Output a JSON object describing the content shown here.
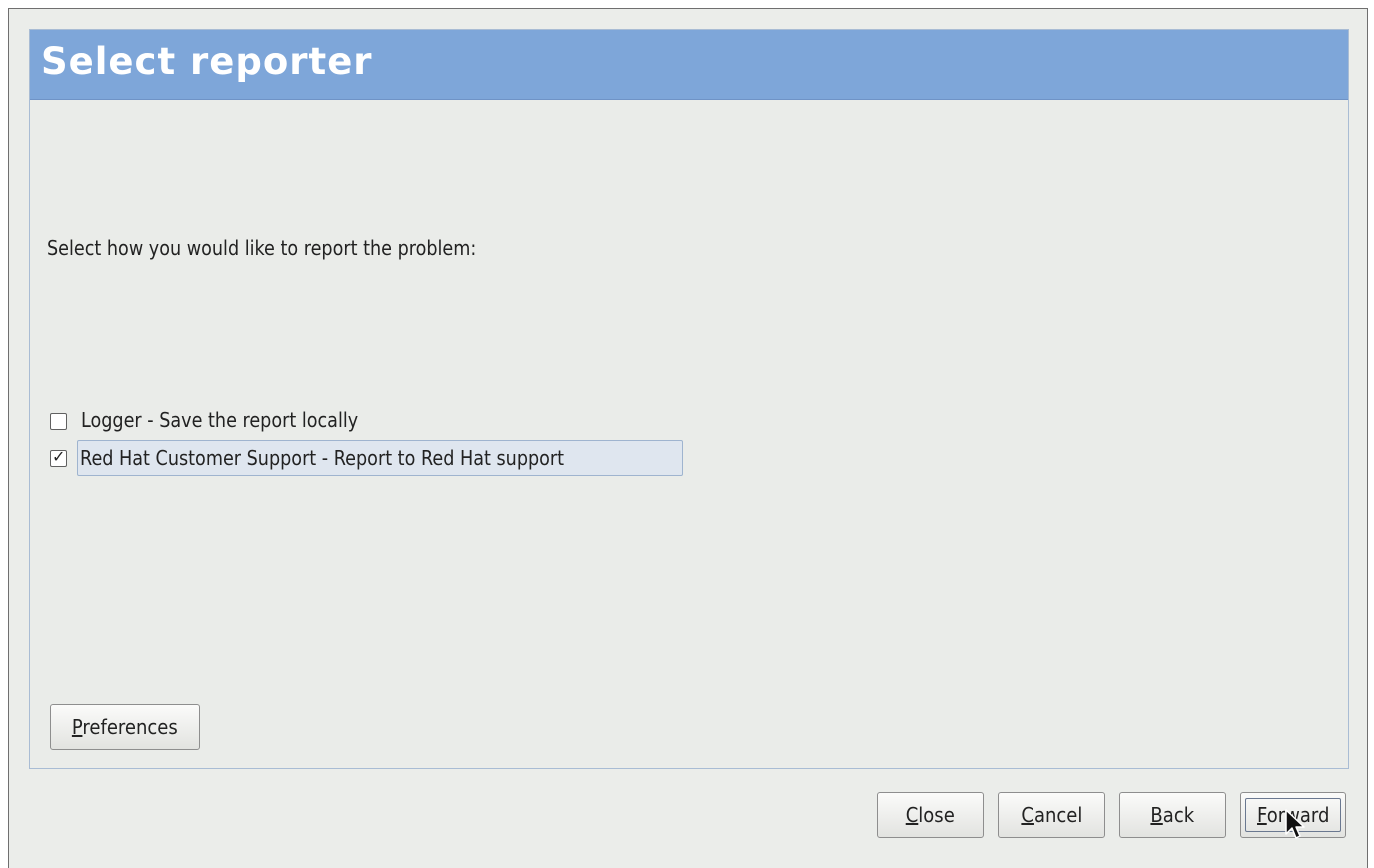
{
  "header": {
    "title": "Select reporter"
  },
  "prompt": "Select how you would like to report the problem:",
  "options": [
    {
      "label": "Logger - Save the report locally",
      "checked": false
    },
    {
      "label": "Red Hat Customer Support - Report to Red Hat support",
      "checked": true
    }
  ],
  "buttons": {
    "preferences": "Preferences",
    "close": "Close",
    "cancel": "Cancel",
    "back": "Back",
    "forward": "Forward"
  },
  "colors": {
    "header_bg": "#7ea6d9",
    "window_bg": "#ebedea",
    "selected_row_bg": "#dfe6ef"
  }
}
